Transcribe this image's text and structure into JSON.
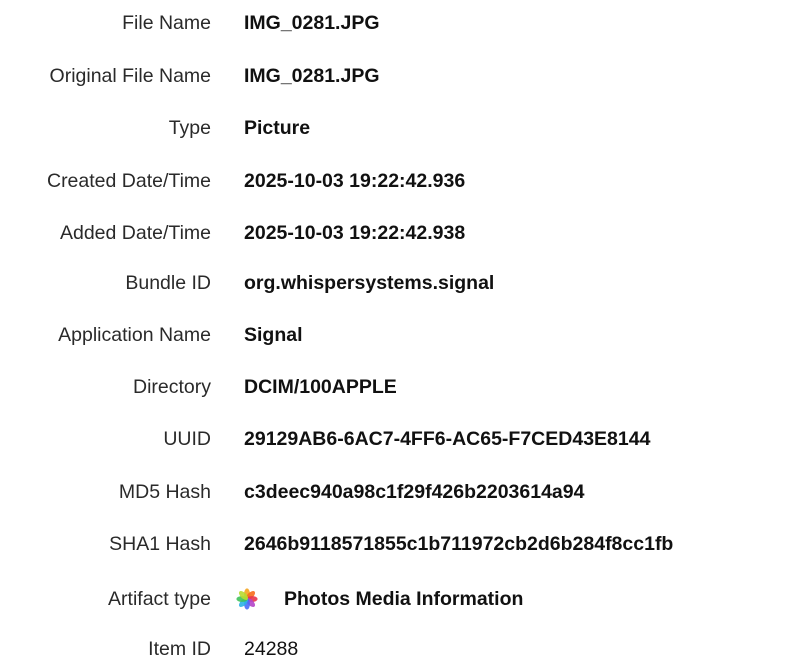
{
  "properties": [
    {
      "label": "File Name",
      "value": "IMG_0281.JPG"
    },
    {
      "label": "Original File Name",
      "value": "IMG_0281.JPG"
    },
    {
      "label": "Type",
      "value": "Picture"
    },
    {
      "label": "Created Date/Time",
      "value": "2025-10-03 19:22:42.936"
    },
    {
      "label": "Added Date/Time",
      "value": "2025-10-03 19:22:42.938"
    },
    {
      "label": "Bundle ID",
      "value": "org.whispersystems.signal"
    },
    {
      "label": "Application Name",
      "value": "Signal"
    },
    {
      "label": "Directory",
      "value": "DCIM/100APPLE"
    },
    {
      "label": "UUID",
      "value": "29129AB6-6AC7-4FF6-AC65-F7CED43E8144"
    },
    {
      "label": "MD5 Hash",
      "value": "c3deec940a98c1f29f426b2203614a94"
    },
    {
      "label": "SHA1 Hash",
      "value": "2646b9118571855c1b711972cb2d6b284f8cc1fb"
    },
    {
      "label": "Artifact type",
      "value": "Photos Media Information",
      "icon": "photos-app-icon"
    },
    {
      "label": "Item ID",
      "value": "24288"
    }
  ]
}
